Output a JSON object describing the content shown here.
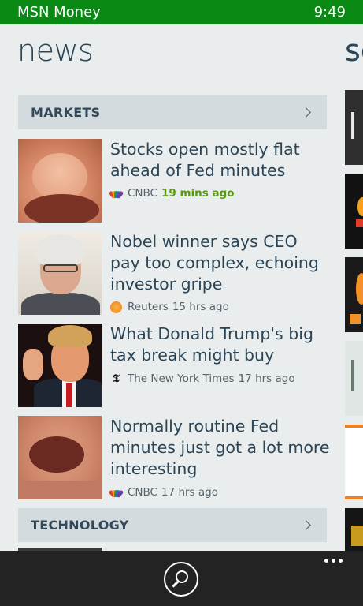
{
  "status_bar": {
    "app_name": "MSN Money",
    "time": "9:49"
  },
  "page": {
    "title": "news",
    "next_panel_title_peek": "sc"
  },
  "sections": [
    {
      "label": "MARKETS"
    },
    {
      "label": "TECHNOLOGY"
    }
  ],
  "news": [
    {
      "headline": "Stocks open mostly flat ahead of Fed minutes",
      "source": "CNBC",
      "time": "19 mins ago",
      "source_icon": "cnbc-peacock-icon",
      "time_color": "#5a9a12"
    },
    {
      "headline": "Nobel winner says CEO pay too complex, echoing investor gripe",
      "source": "Reuters",
      "time": "15 hrs ago",
      "source_icon": "reuters-sun-icon"
    },
    {
      "headline": "What Donald Trump's big tax break might buy",
      "source": "The New York Times",
      "time": "17 hrs ago",
      "source_icon": "nyt-t-icon"
    },
    {
      "headline": "Normally routine Fed minutes just got a lot more interesting",
      "source": "CNBC",
      "time": "17 hrs ago",
      "source_icon": "cnbc-peacock-icon"
    }
  ],
  "app_bar": {
    "search_icon": "search-icon",
    "more_icon": "more-dots-icon"
  },
  "colors": {
    "status_bar": "#0a8a14",
    "background": "#e9edee",
    "section_header": "#d4dbde",
    "app_bar": "#232323"
  }
}
